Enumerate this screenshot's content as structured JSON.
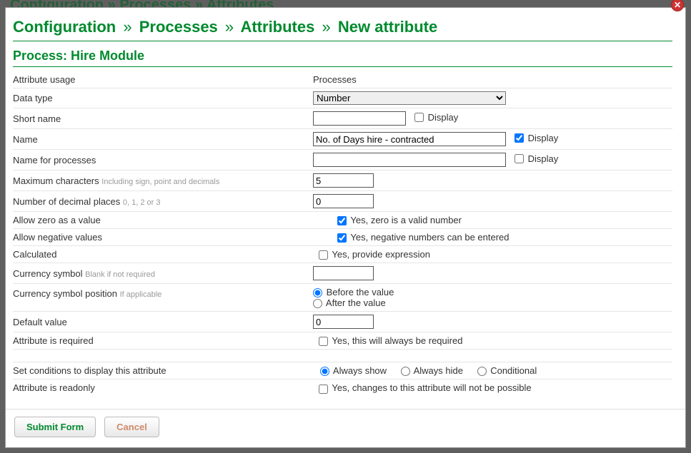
{
  "bg_breadcrumb": "Configuration » Processes » Attributes",
  "breadcrumb": {
    "parts": [
      "Configuration",
      "Processes",
      "Attributes",
      "New attribute"
    ],
    "sep": "»"
  },
  "process_title_prefix": "Process: ",
  "process_title_name": "Hire Module",
  "labels": {
    "attribute_usage": "Attribute usage",
    "data_type": "Data type",
    "short_name": "Short name",
    "name": "Name",
    "name_for_processes": "Name for processes",
    "max_chars": "Maximum characters",
    "max_chars_hint": "Including sign, point and decimals",
    "decimal_places": "Number of decimal places",
    "decimal_places_hint": "0, 1, 2 or 3",
    "allow_zero": "Allow zero as a value",
    "allow_negative": "Allow negative values",
    "calculated": "Calculated",
    "currency_symbol": "Currency symbol",
    "currency_symbol_hint": "Blank if not required",
    "currency_position": "Currency symbol position",
    "currency_position_hint": "If applicable",
    "default_value": "Default value",
    "attribute_required": "Attribute is required",
    "set_conditions": "Set conditions to display this attribute",
    "attribute_readonly": "Attribute is readonly",
    "display": "Display"
  },
  "values": {
    "attribute_usage": "Processes",
    "data_type": "Number",
    "short_name": "",
    "name": "No. of Days hire - contracted",
    "name_for_processes": "",
    "max_chars": "5",
    "decimal_places": "0",
    "currency_symbol": "",
    "default_value": "0"
  },
  "options": {
    "allow_zero_text": "Yes, zero is a valid number",
    "allow_negative_text": "Yes, negative numbers can be entered",
    "calculated_text": "Yes, provide expression",
    "currency_before": "Before the value",
    "currency_after": "After the value",
    "required_text": "Yes, this will always be required",
    "conditions_always_show": "Always show",
    "conditions_always_hide": "Always hide",
    "conditions_conditional": "Conditional",
    "readonly_text": "Yes, changes to this attribute will not be possible"
  },
  "buttons": {
    "submit": "Submit Form",
    "cancel": "Cancel"
  },
  "close_icon": "✕"
}
